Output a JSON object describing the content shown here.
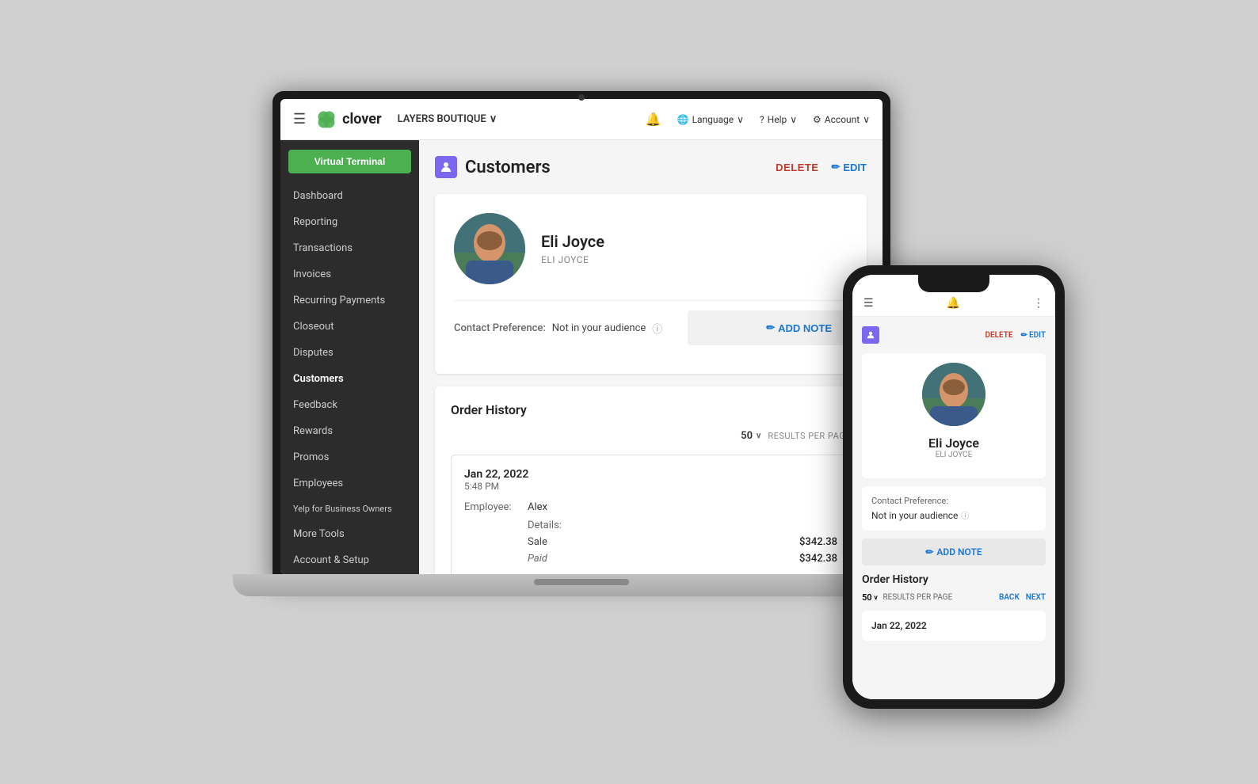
{
  "scene": {
    "background": "#c8c8c8"
  },
  "header": {
    "menu_icon": "☰",
    "logo_text": "clover",
    "store_name": "LAYERS BOUTIQUE",
    "store_chevron": "∨",
    "bell_icon": "🔔",
    "language_label": "Language",
    "help_label": "Help",
    "account_label": "Account"
  },
  "sidebar": {
    "virtual_terminal_label": "Virtual Terminal",
    "items": [
      {
        "id": "dashboard",
        "label": "Dashboard",
        "active": false
      },
      {
        "id": "reporting",
        "label": "Reporting",
        "active": false
      },
      {
        "id": "transactions",
        "label": "Transactions",
        "active": false
      },
      {
        "id": "invoices",
        "label": "Invoices",
        "active": false
      },
      {
        "id": "recurring-payments",
        "label": "Recurring Payments",
        "active": false
      },
      {
        "id": "closeout",
        "label": "Closeout",
        "active": false
      },
      {
        "id": "disputes",
        "label": "Disputes",
        "active": false
      },
      {
        "id": "customers",
        "label": "Customers",
        "active": true
      },
      {
        "id": "feedback",
        "label": "Feedback",
        "active": false
      },
      {
        "id": "rewards",
        "label": "Rewards",
        "active": false
      },
      {
        "id": "promos",
        "label": "Promos",
        "active": false
      },
      {
        "id": "employees",
        "label": "Employees",
        "active": false
      },
      {
        "id": "yelp",
        "label": "Yelp for Business Owners",
        "active": false
      },
      {
        "id": "more-tools",
        "label": "More Tools",
        "active": false
      },
      {
        "id": "account-setup",
        "label": "Account & Setup",
        "active": false
      }
    ]
  },
  "main": {
    "page_title": "Customers",
    "delete_label": "DELETE",
    "edit_label": "EDIT",
    "customer": {
      "name": "Eli Joyce",
      "id_text": "ELI JOYCE",
      "contact_pref_label": "Contact Preference:",
      "contact_pref_value": "Not in your audience",
      "add_note_label": "ADD NOTE"
    },
    "order_history": {
      "title": "Order History",
      "results_per_page_label": "RESULTS PER PAGE",
      "results_count": "50",
      "order": {
        "date": "Jan 22, 2022",
        "time": "5:48 PM",
        "employee_label": "Employee:",
        "employee_value": "Alex",
        "details_label": "Details:",
        "sale_label": "Sale",
        "sale_amount": "$342.38",
        "paid_label": "Paid",
        "paid_amount": "$342.38"
      }
    }
  },
  "phone": {
    "delete_label": "DELETE",
    "edit_label": "EDIT",
    "customer": {
      "name": "Eli Joyce",
      "id_text": "ELI JOYCE",
      "contact_pref_label": "Contact Preference:",
      "contact_pref_value": "Not in your audience",
      "add_note_label": "ADD NOTE"
    },
    "order_history": {
      "title": "Order History",
      "results_count": "50",
      "results_per_page": "RESULTS PER PAGE",
      "back_label": "BACK",
      "next_label": "NEXT",
      "order_date": "Jan 22, 2022"
    }
  }
}
